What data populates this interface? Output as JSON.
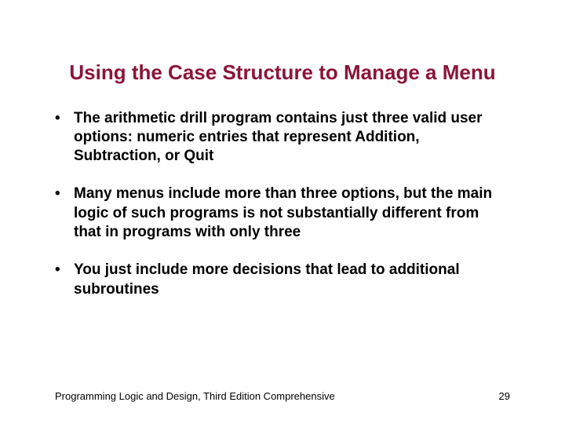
{
  "title": "Using the Case Structure to Manage a Menu",
  "bullets": [
    "The arithmetic drill program contains just three valid user options: numeric entries that represent Addition, Subtraction, or Quit",
    "Many menus include more than three options, but the main logic of such programs is not substantially different from that in programs with only three",
    "You just include more decisions that lead to additional subroutines"
  ],
  "footer": {
    "left": "Programming Logic and Design, Third Edition Comprehensive",
    "right": "29"
  }
}
